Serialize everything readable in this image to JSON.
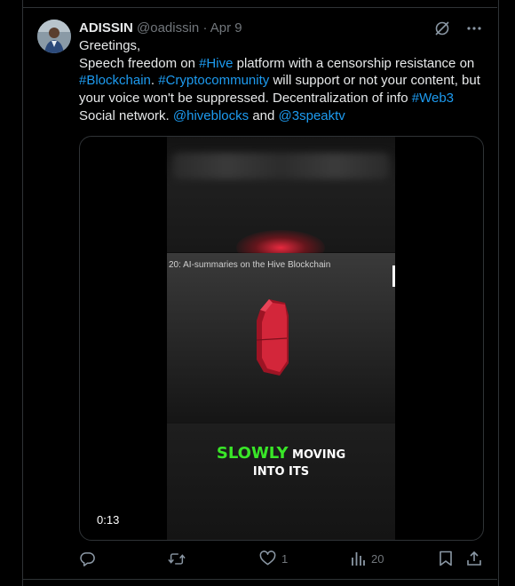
{
  "tweet": {
    "author_name": "ADISSIN",
    "handle": "@oadissin",
    "separator": "·",
    "date": "Apr 9",
    "text": {
      "greeting": "Greetings,",
      "p1": "Speech freedom on ",
      "hashtag_hive": "#Hive",
      "p2": " platform with a censorship resistance on ",
      "hashtag_blockchain": "#Blockchain",
      "p3": ". ",
      "hashtag_crypto": "#Cryptocommunity",
      "p4": " will support or not your content, but your voice won't be suppressed. Decentralization of info ",
      "hashtag_web3": "#Web3",
      "p5": " Social network. ",
      "mention_hiveblocks": "@hiveblocks",
      "p6": " and ",
      "mention_3speak": "@3speaktv"
    }
  },
  "video": {
    "panel_title": "20: AI-summaries on the Hive Blockchain",
    "caption_green": "SLOWLY",
    "caption_white": " MOVING",
    "caption_line2": "INTO ITS",
    "timestamp": "0:13"
  },
  "actions": {
    "reply_count": "",
    "retweet_count": "",
    "like_count": "1",
    "views_count": "20"
  },
  "colors": {
    "accent": "#1d9bf0",
    "muted": "#71767b",
    "caption_green": "#39e628"
  }
}
